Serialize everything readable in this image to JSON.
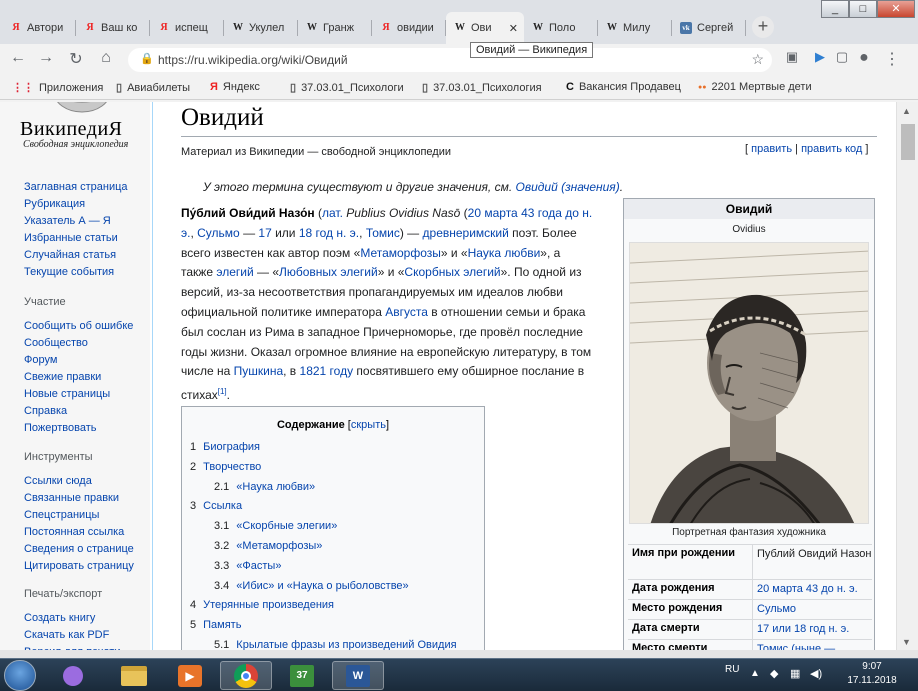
{
  "browser": {
    "tabs": [
      {
        "favicon": "yandex-icon",
        "title": "Автори"
      },
      {
        "favicon": "yandex-icon",
        "title": "Ваш ко"
      },
      {
        "favicon": "yandex-icon",
        "title": "испещ"
      },
      {
        "favicon": "wikipedia-icon",
        "title": "Укулел"
      },
      {
        "favicon": "wikipedia-icon",
        "title": "Гранж"
      },
      {
        "favicon": "yandex-icon",
        "title": "овидии"
      },
      {
        "favicon": "wikipedia-icon",
        "title": "Ови",
        "active": true
      },
      {
        "favicon": "wikipedia-icon",
        "title": "Поло"
      },
      {
        "favicon": "wikipedia-icon",
        "title": "Милу"
      },
      {
        "favicon": "vk-icon",
        "title": "Сергей"
      }
    ],
    "tab_tooltip": "Овидий — Википедия",
    "url": "https://ru.wikipedia.org/wiki/Овидий",
    "bookmarks": [
      {
        "icon": "apps-icon",
        "label": "Приложения"
      },
      {
        "icon": "page-icon",
        "label": "Авиабилеты"
      },
      {
        "icon": "yandex-icon",
        "label": "Яндекс"
      },
      {
        "icon": "page-icon",
        "label": "37.03.01_Психологи"
      },
      {
        "icon": "page-icon",
        "label": "37.03.01_Психология"
      },
      {
        "icon": "c-icon",
        "label": "Вакансия Продавец"
      },
      {
        "icon": "dots-icon",
        "label": "2201 Мертвые дети"
      }
    ]
  },
  "sidebar": {
    "logo_title": "ВикипедиЯ",
    "logo_subtitle": "Свободная энциклопедия",
    "nav": [
      "Заглавная страница",
      "Рубрикация",
      "Указатель А — Я",
      "Избранные статьи",
      "Случайная статья",
      "Текущие события"
    ],
    "participation_heading": "Участие",
    "participation": [
      "Сообщить об ошибке",
      "Сообщество",
      "Форум",
      "Свежие правки",
      "Новые страницы",
      "Справка",
      "Пожертвовать"
    ],
    "tools_heading": "Инструменты",
    "tools": [
      "Ссылки сюда",
      "Связанные правки",
      "Спецстраницы",
      "Постоянная ссылка",
      "Сведения о странице",
      "Цитировать страницу"
    ],
    "print_heading": "Печать/экспорт",
    "print": [
      "Создать книгу",
      "Скачать как PDF",
      "Версия для печати"
    ]
  },
  "article": {
    "title": "Овидий",
    "subtitle": "Материал из Википедии — свободной энциклопедии",
    "edit_open": "[ ",
    "edit": "править",
    "edit_sep": " | ",
    "edit_code": "править код",
    "edit_close": " ]",
    "hatnote_prefix": "У этого термина существуют и другие значения, см. ",
    "hatnote_link": "Овидий (значения)",
    "hatnote_suffix": ".",
    "lead": [
      {
        "t": "Пу́блий Ови́дий Назо́н",
        "b": true
      },
      {
        "t": " ("
      },
      {
        "t": "лат.",
        "l": true
      },
      {
        "t": " "
      },
      {
        "t": "Publius Ovidius Nasō",
        "i": true
      },
      {
        "t": " ("
      },
      {
        "t": "20 марта",
        "l": true
      },
      {
        "t": " "
      },
      {
        "t": "43 года до н. э.",
        "l": true
      },
      {
        "t": ", "
      },
      {
        "t": "Сульмо",
        "l": true
      },
      {
        "t": " — "
      },
      {
        "t": "17",
        "l": true
      },
      {
        "t": " или "
      },
      {
        "t": "18 год н. э.",
        "l": true
      },
      {
        "t": ", "
      },
      {
        "t": "Томис",
        "l": true
      },
      {
        "t": ") — "
      },
      {
        "t": "древнеримский",
        "l": true
      },
      {
        "t": " поэт. Более всего известен как автор поэм «"
      },
      {
        "t": "Метаморфозы",
        "l": true
      },
      {
        "t": "» и «"
      },
      {
        "t": "Наука любви",
        "l": true
      },
      {
        "t": "», а также "
      },
      {
        "t": "элегий",
        "l": true
      },
      {
        "t": " — «"
      },
      {
        "t": "Любовных элегий",
        "l": true
      },
      {
        "t": "» и «"
      },
      {
        "t": "Скорбных элегий",
        "l": true
      },
      {
        "t": "». По одной из версий, из-за несоответствия пропагандируемых им идеалов любви официальной политике императора "
      },
      {
        "t": "Августа",
        "l": true
      },
      {
        "t": " в отношении семьи и брака был сослан из Рима в западное Причерноморье, где провёл последние годы жизни. Оказал огромное влияние на европейскую литературу, в том числе на "
      },
      {
        "t": "Пушкина",
        "l": true
      },
      {
        "t": ", в "
      },
      {
        "t": "1821 году",
        "l": true
      },
      {
        "t": " посвятившего ему обширное послание в стихах"
      },
      {
        "t": "[1]",
        "sup": true
      },
      {
        "t": "."
      }
    ],
    "toc": {
      "title": "Содержание",
      "toggle_open": " [",
      "toggle": "скрыть",
      "toggle_close": "]",
      "items": [
        {
          "num": "1",
          "label": "Биография",
          "level": 1
        },
        {
          "num": "2",
          "label": "Творчество",
          "level": 1
        },
        {
          "num": "2.1",
          "label": "«Наука любви»",
          "level": 2
        },
        {
          "num": "3",
          "label": "Ссылка",
          "level": 1
        },
        {
          "num": "3.1",
          "label": "«Скорбные элегии»",
          "level": 2
        },
        {
          "num": "3.2",
          "label": "«Метаморфозы»",
          "level": 2
        },
        {
          "num": "3.3",
          "label": "«Фасты»",
          "level": 2
        },
        {
          "num": "3.4",
          "label": "«Ибис» и «Наука о рыболовстве»",
          "level": 2
        },
        {
          "num": "4",
          "label": "Утерянные произведения",
          "level": 1
        },
        {
          "num": "5",
          "label": "Память",
          "level": 1
        },
        {
          "num": "5.1",
          "label": "Крылатые фразы из произведений Овидия",
          "level": 2
        }
      ]
    }
  },
  "infobox": {
    "title": "Овидий",
    "original_name": "Ovidius",
    "caption": "Портретная фантазия художника",
    "rows": [
      {
        "label": "Имя при рождении",
        "value": "Публий Овидий Назон",
        "link": false
      },
      {
        "label": "Дата рождения",
        "value": "20 марта 43 до н. э.",
        "link": true
      },
      {
        "label": "Место рождения",
        "value": "Сульмо",
        "link": true
      },
      {
        "label": "Дата смерти",
        "value": "17 или 18 год н. э.",
        "link": true
      },
      {
        "label": "Место смерти",
        "value": "Томис (ныне —",
        "link": true
      }
    ]
  },
  "taskbar": {
    "language": "RU",
    "time": "9:07",
    "date": "17.11.2018"
  }
}
